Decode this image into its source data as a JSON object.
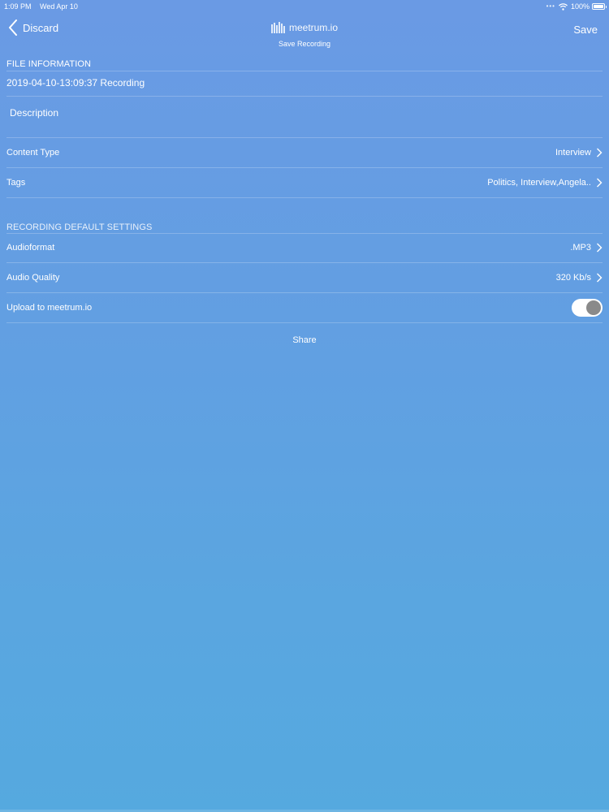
{
  "status_bar": {
    "time": "1:09 PM",
    "date": "Wed Apr 10",
    "battery_percent": "100%",
    "battery_level": 1.0
  },
  "nav": {
    "back_label": "Discard",
    "save_label": "Save",
    "logo_text": "meetrum.io",
    "subtitle": "Save Recording"
  },
  "file_information": {
    "header": "FILE INFORMATION",
    "recording_name": "2019-04-10-13:09:37 Recording",
    "description_placeholder": "Description",
    "rows": [
      {
        "label": "Content Type",
        "value": "Interview"
      },
      {
        "label": "Tags",
        "value": "Politics, Interview,Angela.."
      }
    ]
  },
  "recording_settings": {
    "header": "RECORDING DEFAULT SETTINGS",
    "rows": [
      {
        "label": "Audioformat",
        "value": ".MP3"
      },
      {
        "label": "Audio Quality",
        "value": "320 Kb/s"
      }
    ],
    "upload": {
      "label": "Upload to meetrum.io",
      "enabled": true
    }
  },
  "share_label": "Share",
  "icons": {
    "back": "chevron-left-icon",
    "row": "chevron-right-icon",
    "logo": "waveform-logo-icon",
    "wifi": "wifi-icon",
    "battery": "battery-icon"
  },
  "colors": {
    "background_top": "#6a9ae4",
    "background_bottom": "#55a9df",
    "text": "#ffffff",
    "toggle_knob": "#8a8a8a"
  }
}
